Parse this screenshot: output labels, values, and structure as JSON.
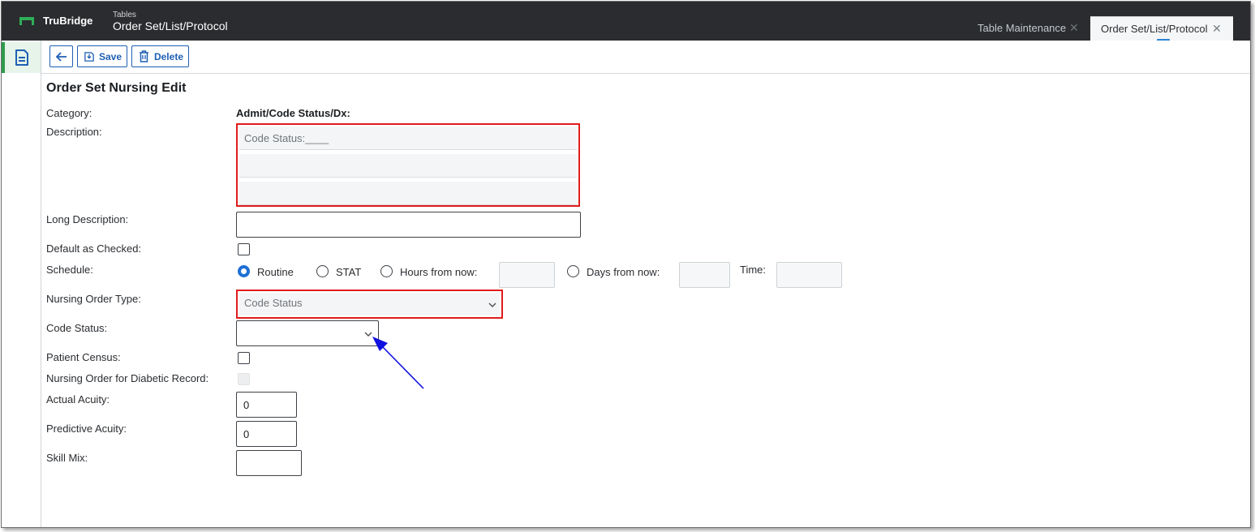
{
  "header": {
    "brand": "TruBridge",
    "breadcrumb_small": "Tables",
    "breadcrumb_title": "Order Set/List/Protocol",
    "tabs": [
      {
        "label": "Table Maintenance",
        "active": false
      },
      {
        "label": "Order Set/List/Protocol",
        "active": true
      }
    ],
    "close_glyph": "✕"
  },
  "toolbar": {
    "back_icon": "arrow-left-icon",
    "save_label": "Save",
    "delete_label": "Delete"
  },
  "form": {
    "title": "Order Set Nursing Edit",
    "category_label": "Category:",
    "category_value": "Admit/Code Status/Dx:",
    "description_label": "Description:",
    "description_lines": [
      "Code Status:____",
      "",
      ""
    ],
    "long_description_label": "Long Description:",
    "long_description_value": "",
    "default_checked_label": "Default as Checked:",
    "schedule_label": "Schedule:",
    "schedule_options": [
      "Routine",
      "STAT",
      "Hours from now:",
      "Days from now:"
    ],
    "schedule_selected": "Routine",
    "time_label": "Time:",
    "nursing_order_type_label": "Nursing Order Type:",
    "nursing_order_type_value": "Code Status",
    "code_status_label": "Code Status:",
    "code_status_value": "",
    "patient_census_label": "Patient Census:",
    "diabetic_label": "Nursing Order for Diabetic Record:",
    "actual_acuity_label": "Actual Acuity:",
    "actual_acuity_value": "0",
    "predictive_acuity_label": "Predictive Acuity:",
    "predictive_acuity_value": "0",
    "skill_mix_label": "Skill Mix:",
    "skill_mix_value": ""
  },
  "colors": {
    "topbar": "#2a2c2f",
    "accent_blue": "#1e5fb3",
    "highlight_red": "#e01b1b",
    "annotation_arrow": "#1010e0",
    "rail_green": "#2e9b4e"
  }
}
